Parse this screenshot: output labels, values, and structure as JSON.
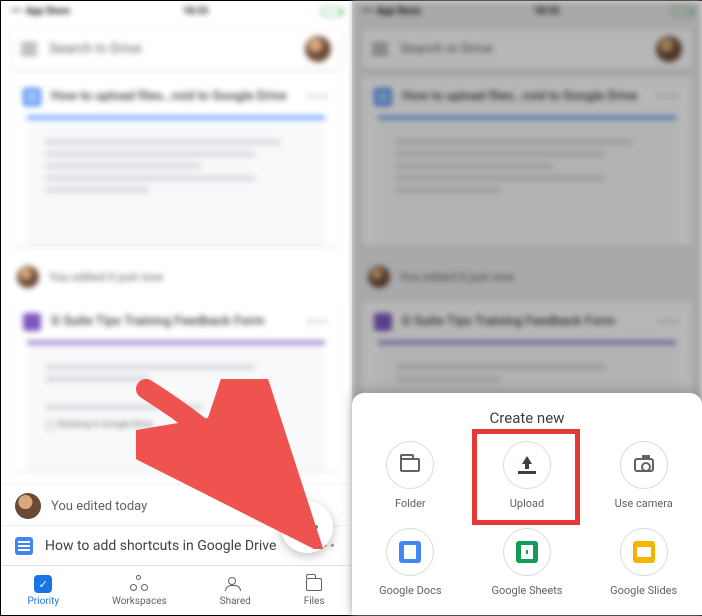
{
  "status": {
    "carrier": "App Store",
    "time": "18:33"
  },
  "search": {
    "placeholder": "Search in Drive"
  },
  "cards": [
    {
      "title": "How to upload files…roid to Google Drive",
      "type": "doc"
    },
    {
      "title": "G Suite Tips Training Feedback Form",
      "type": "form"
    }
  ],
  "edit_lines": {
    "just_now": "You edited it just now",
    "today": "You edited today"
  },
  "file_row": {
    "title": "How to add shortcuts in Google Drive"
  },
  "form_note": "Working in Google Drive",
  "nav": {
    "priority": "Priority",
    "workspaces": "Workspaces",
    "shared": "Shared",
    "files": "Files"
  },
  "sheet": {
    "title": "Create new",
    "options": {
      "folder": "Folder",
      "upload": "Upload",
      "camera": "Use camera",
      "docs": "Google Docs",
      "sheets": "Google Sheets",
      "slides": "Google Slides"
    }
  }
}
